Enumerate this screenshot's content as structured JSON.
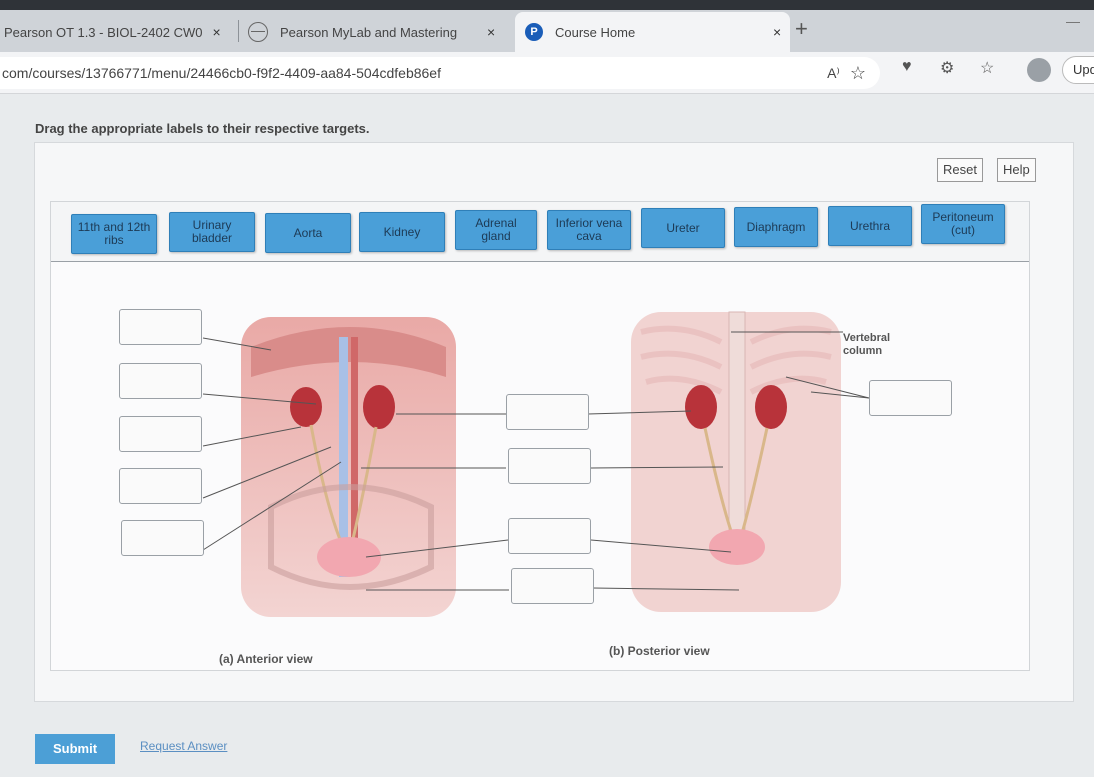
{
  "browser": {
    "tabs": [
      {
        "label": "Pearson OT 1.3 - BIOL-2402 CW0"
      },
      {
        "label": "Pearson MyLab and Mastering"
      },
      {
        "label": "Course Home"
      }
    ],
    "close_glyph": "×",
    "new_tab_glyph": "+",
    "url": "com/courses/13766771/menu/24466cb0-f9f2-4409-aa84-504cdfeb86ef",
    "read_aloud": "A⁾",
    "update_label": "Upd"
  },
  "instruction": "Drag the appropriate labels to their respective targets.",
  "toolbar": {
    "reset_label": "Reset",
    "help_label": "Help"
  },
  "labels": [
    "11th and 12th ribs",
    "Urinary bladder",
    "Aorta",
    "Kidney",
    "Adrenal gland",
    "Inferior vena cava",
    "Ureter",
    "Diaphragm",
    "Urethra",
    "Peritoneum (cut)"
  ],
  "figure": {
    "anterior_caption": "(a) Anterior view",
    "posterior_caption": "(b) Posterior view",
    "vertebral_label": "Vertebral column",
    "drop_target_count": 10
  },
  "footer": {
    "submit_label": "Submit",
    "request_label": "Request Answer"
  }
}
